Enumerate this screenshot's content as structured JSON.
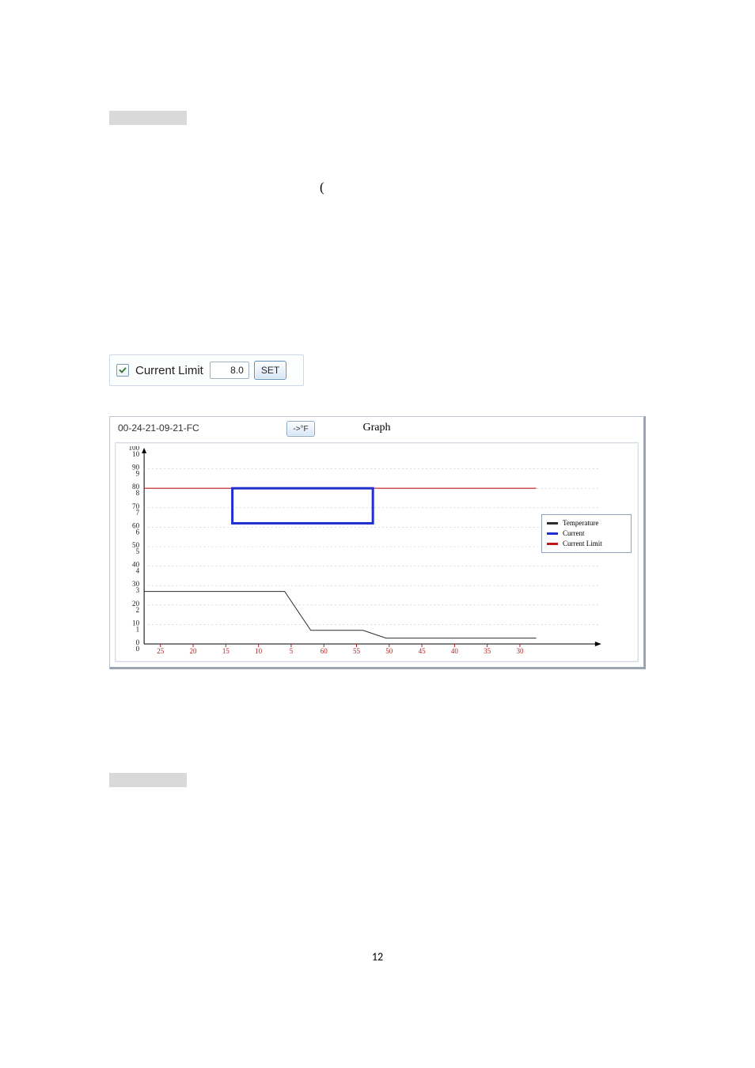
{
  "page_number": "12",
  "paren_text": "(",
  "control": {
    "checkbox_checked": true,
    "label": "Current Limit",
    "value": "8.0",
    "set_label": "SET"
  },
  "graph_panel": {
    "mac": "00-24-21-09-21-FC",
    "tof_btn": "->°F",
    "title": "Graph",
    "legend": {
      "items": [
        {
          "label": "Temperature",
          "color": "#2b2b2b"
        },
        {
          "label": "Current",
          "color": "#2030d0"
        },
        {
          "label": "Current Limit",
          "color": "#c01818"
        }
      ]
    }
  },
  "chart_data": {
    "type": "line",
    "title": "Graph",
    "left_axis": {
      "min": 0,
      "max": 100,
      "ticks": [
        0,
        10,
        20,
        30,
        40,
        50,
        60,
        70,
        80,
        90,
        100
      ]
    },
    "right_axis_labels": [
      "0",
      "1",
      "2",
      "3",
      "4",
      "5",
      "6",
      "7",
      "8",
      "9",
      "10"
    ],
    "x_axis": {
      "labels": [
        "25",
        "20",
        "15",
        "10",
        "5",
        "60",
        "55",
        "50",
        "45",
        "40",
        "35",
        "30"
      ]
    },
    "series": [
      {
        "name": "Current Limit",
        "color": "#c01818",
        "points": [
          {
            "xi": 0,
            "y": 80
          },
          {
            "xi": 12,
            "y": 80
          }
        ]
      },
      {
        "name": "Temperature",
        "color": "#2b2b2b",
        "points": [
          {
            "xi": 0,
            "y": 27
          },
          {
            "xi": 4.3,
            "y": 27
          },
          {
            "xi": 5.1,
            "y": 7
          },
          {
            "xi": 6.7,
            "y": 7
          },
          {
            "xi": 7.4,
            "y": 3
          },
          {
            "xi": 12,
            "y": 3
          }
        ]
      },
      {
        "name": "Current",
        "color": "#2030d0",
        "style": "box",
        "box": {
          "x0": 2.7,
          "x1": 7.0,
          "y0": 62,
          "y1": 80
        }
      }
    ]
  }
}
